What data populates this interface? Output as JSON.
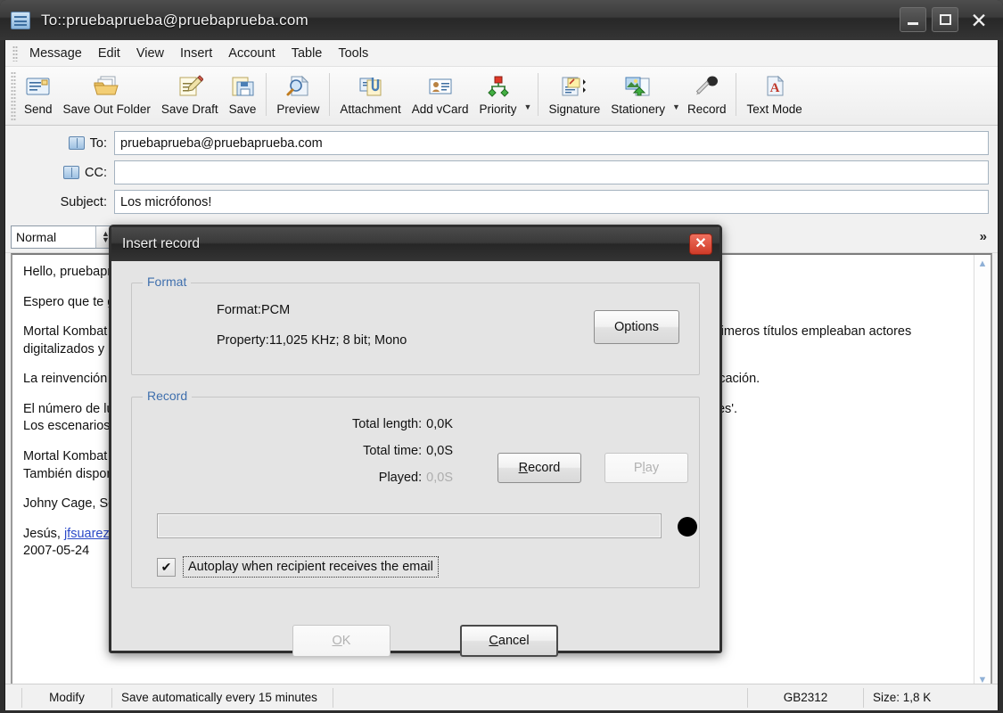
{
  "window": {
    "title": "To::pruebaprueba@pruebaprueba.com",
    "icon": "mail-window-icon",
    "controls": {
      "minimize": "–",
      "maximize": "□",
      "close": "✕"
    }
  },
  "menubar": {
    "items": [
      {
        "label": "Message"
      },
      {
        "label": "Edit"
      },
      {
        "label": "View"
      },
      {
        "label": "Insert"
      },
      {
        "label": "Account"
      },
      {
        "label": "Table"
      },
      {
        "label": "Tools"
      }
    ]
  },
  "toolbar": {
    "buttons": [
      {
        "label": "Send",
        "icon": "send-envelope-icon"
      },
      {
        "label": "Save Out Folder",
        "icon": "outbox-folder-icon"
      },
      {
        "label": "Save Draft",
        "icon": "draft-pencil-icon"
      },
      {
        "label": "Save",
        "icon": "floppy-disk-icon"
      },
      {
        "label": "Preview",
        "icon": "magnifier-page-icon"
      },
      {
        "label": "Attachment",
        "icon": "paperclip-icon"
      },
      {
        "label": "Add vCard",
        "icon": "contact-card-icon"
      },
      {
        "label": "Priority",
        "icon": "priority-diamonds-icon"
      },
      {
        "label": "Signature",
        "icon": "signature-note-icon"
      },
      {
        "label": "Stationery",
        "icon": "stationery-image-icon"
      },
      {
        "label": "Record",
        "icon": "microphone-icon"
      },
      {
        "label": "Text Mode",
        "icon": "text-mode-a-icon"
      }
    ]
  },
  "fields": {
    "to": {
      "label": "To:",
      "value": "pruebaprueba@pruebaprueba.com",
      "icon": "address-book-icon"
    },
    "cc": {
      "label": "CC:",
      "value": "",
      "icon": "address-book-icon"
    },
    "subject": {
      "label": "Subject:",
      "value": "Los micrófonos!"
    }
  },
  "formatbar": {
    "style": {
      "value": "Normal"
    },
    "buttons": [
      {
        "icon": "insert-image-icon",
        "enabled": true
      },
      {
        "icon": "insert-link-icon",
        "enabled": false
      },
      {
        "icon": "insert-table-icon",
        "enabled": true
      },
      {
        "icon": "numbered-list-icon",
        "enabled": true
      },
      {
        "icon": "bulleted-list-icon",
        "enabled": true
      },
      {
        "icon": "align-left-icon",
        "enabled": true
      },
      {
        "icon": "align-justify-icon",
        "enabled": true
      }
    ],
    "overflow": "»"
  },
  "body": {
    "paragraphs": [
      "Hello, pruebaprueba",
      "Espero que te guste esta información.",
      "Mortal Kombat es una de las sagas de videojuegos de lucha más famosas desde su aparición hasta nuestros días. Los primeros títulos empleaban actores digitalizados y mucha sangre, lo que les valió una gran polémica que les dio aún más vida.",
      "La reinvención de la saga llegó con este título, que cambió las dos dimensiones por tres y con ellas la jugabilidad y la aplicación.",
      "El número de luchadores asciende a más de veinte, cada uno con su estilo de lucha, combos, golpes especiales y 'fatalities'.",
      "Los escenarios también tienen su protagonismo con trampas mortales que harán las delicias en más de una ocasión.",
      "Mortal Kombat Armageddon incluye un modo historia y un modo carrera de coches.",
      "También disponible el modo cooperativo para que dos jugadores lleven cada uno a un personaje al mismo tiempo.",
      "Johny Cage, Sonya, Sub-Zero, Scorpion, Raiden y muchos más te esperan."
    ],
    "signature_name": "Jesús",
    "signature_link": "jfsuarez@example.com",
    "signature_date": "2007-05-24"
  },
  "statusbar": {
    "modify": "Modify",
    "autosave": "Save automatically every 15 minutes",
    "encoding": "GB2312",
    "size": "Size: 1,8 K"
  },
  "dialog": {
    "title": "Insert record",
    "close_icon": "close-icon",
    "format_group": {
      "title": "Format",
      "format_line": "Format:PCM",
      "property_line": "Property:11,025 KHz; 8 bit; Mono",
      "options_button": "Options"
    },
    "record_group": {
      "title": "Record",
      "total_length_label": "Total length:",
      "total_length_value": "0,0K",
      "total_time_label": "Total time:",
      "total_time_value": "0,0S",
      "played_label": "Played:",
      "played_value": "0,0S",
      "record_button": "Record",
      "play_button": "Play",
      "record_indicator": "record-dot-icon",
      "autoplay_label": "Autoplay when recipient receives the email",
      "autoplay_checked": "✔"
    },
    "ok_button": "OK",
    "cancel_button": "Cancel"
  },
  "colors": {
    "group_label": "#3f6fad",
    "dialog_bg": "#e4e4e4",
    "titlebar": "#333333",
    "close_red": "#cf3b28",
    "link": "#2b49c8"
  }
}
